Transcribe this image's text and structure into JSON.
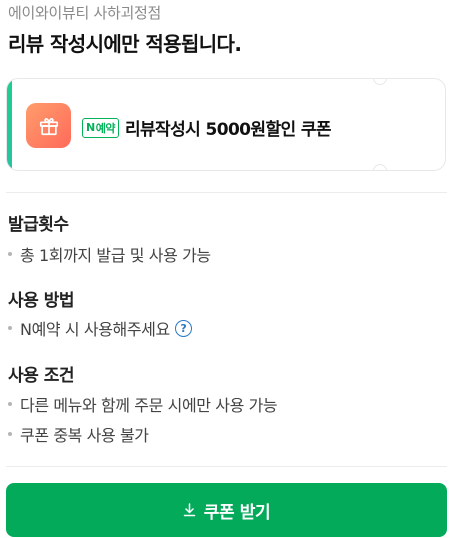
{
  "header": {
    "store_name": "에이와이뷰티 사하괴정점",
    "headline": "리뷰 작성시에만 적용됩니다."
  },
  "coupon": {
    "badge_n": "N",
    "badge_label": "예약",
    "title": "리뷰작성시 5000원할인 쿠폰",
    "icon": "gift-icon",
    "accent_color": "#1fcd8e"
  },
  "sections": [
    {
      "title": "발급횟수",
      "items": [
        "총 1회까지 발급 및 사용 가능"
      ]
    },
    {
      "title": "사용 방법",
      "items": [
        "N예약 시 사용해주세요"
      ]
    },
    {
      "title": "사용 조건",
      "items": [
        "다른 메뉴와 함께 주문 시에만 사용 가능",
        "쿠폰 중복 사용 불가"
      ]
    }
  ],
  "help_icon_glyph": "?",
  "footer": {
    "download_label": "쿠폰 받기",
    "button_color": "#03aa5a"
  }
}
